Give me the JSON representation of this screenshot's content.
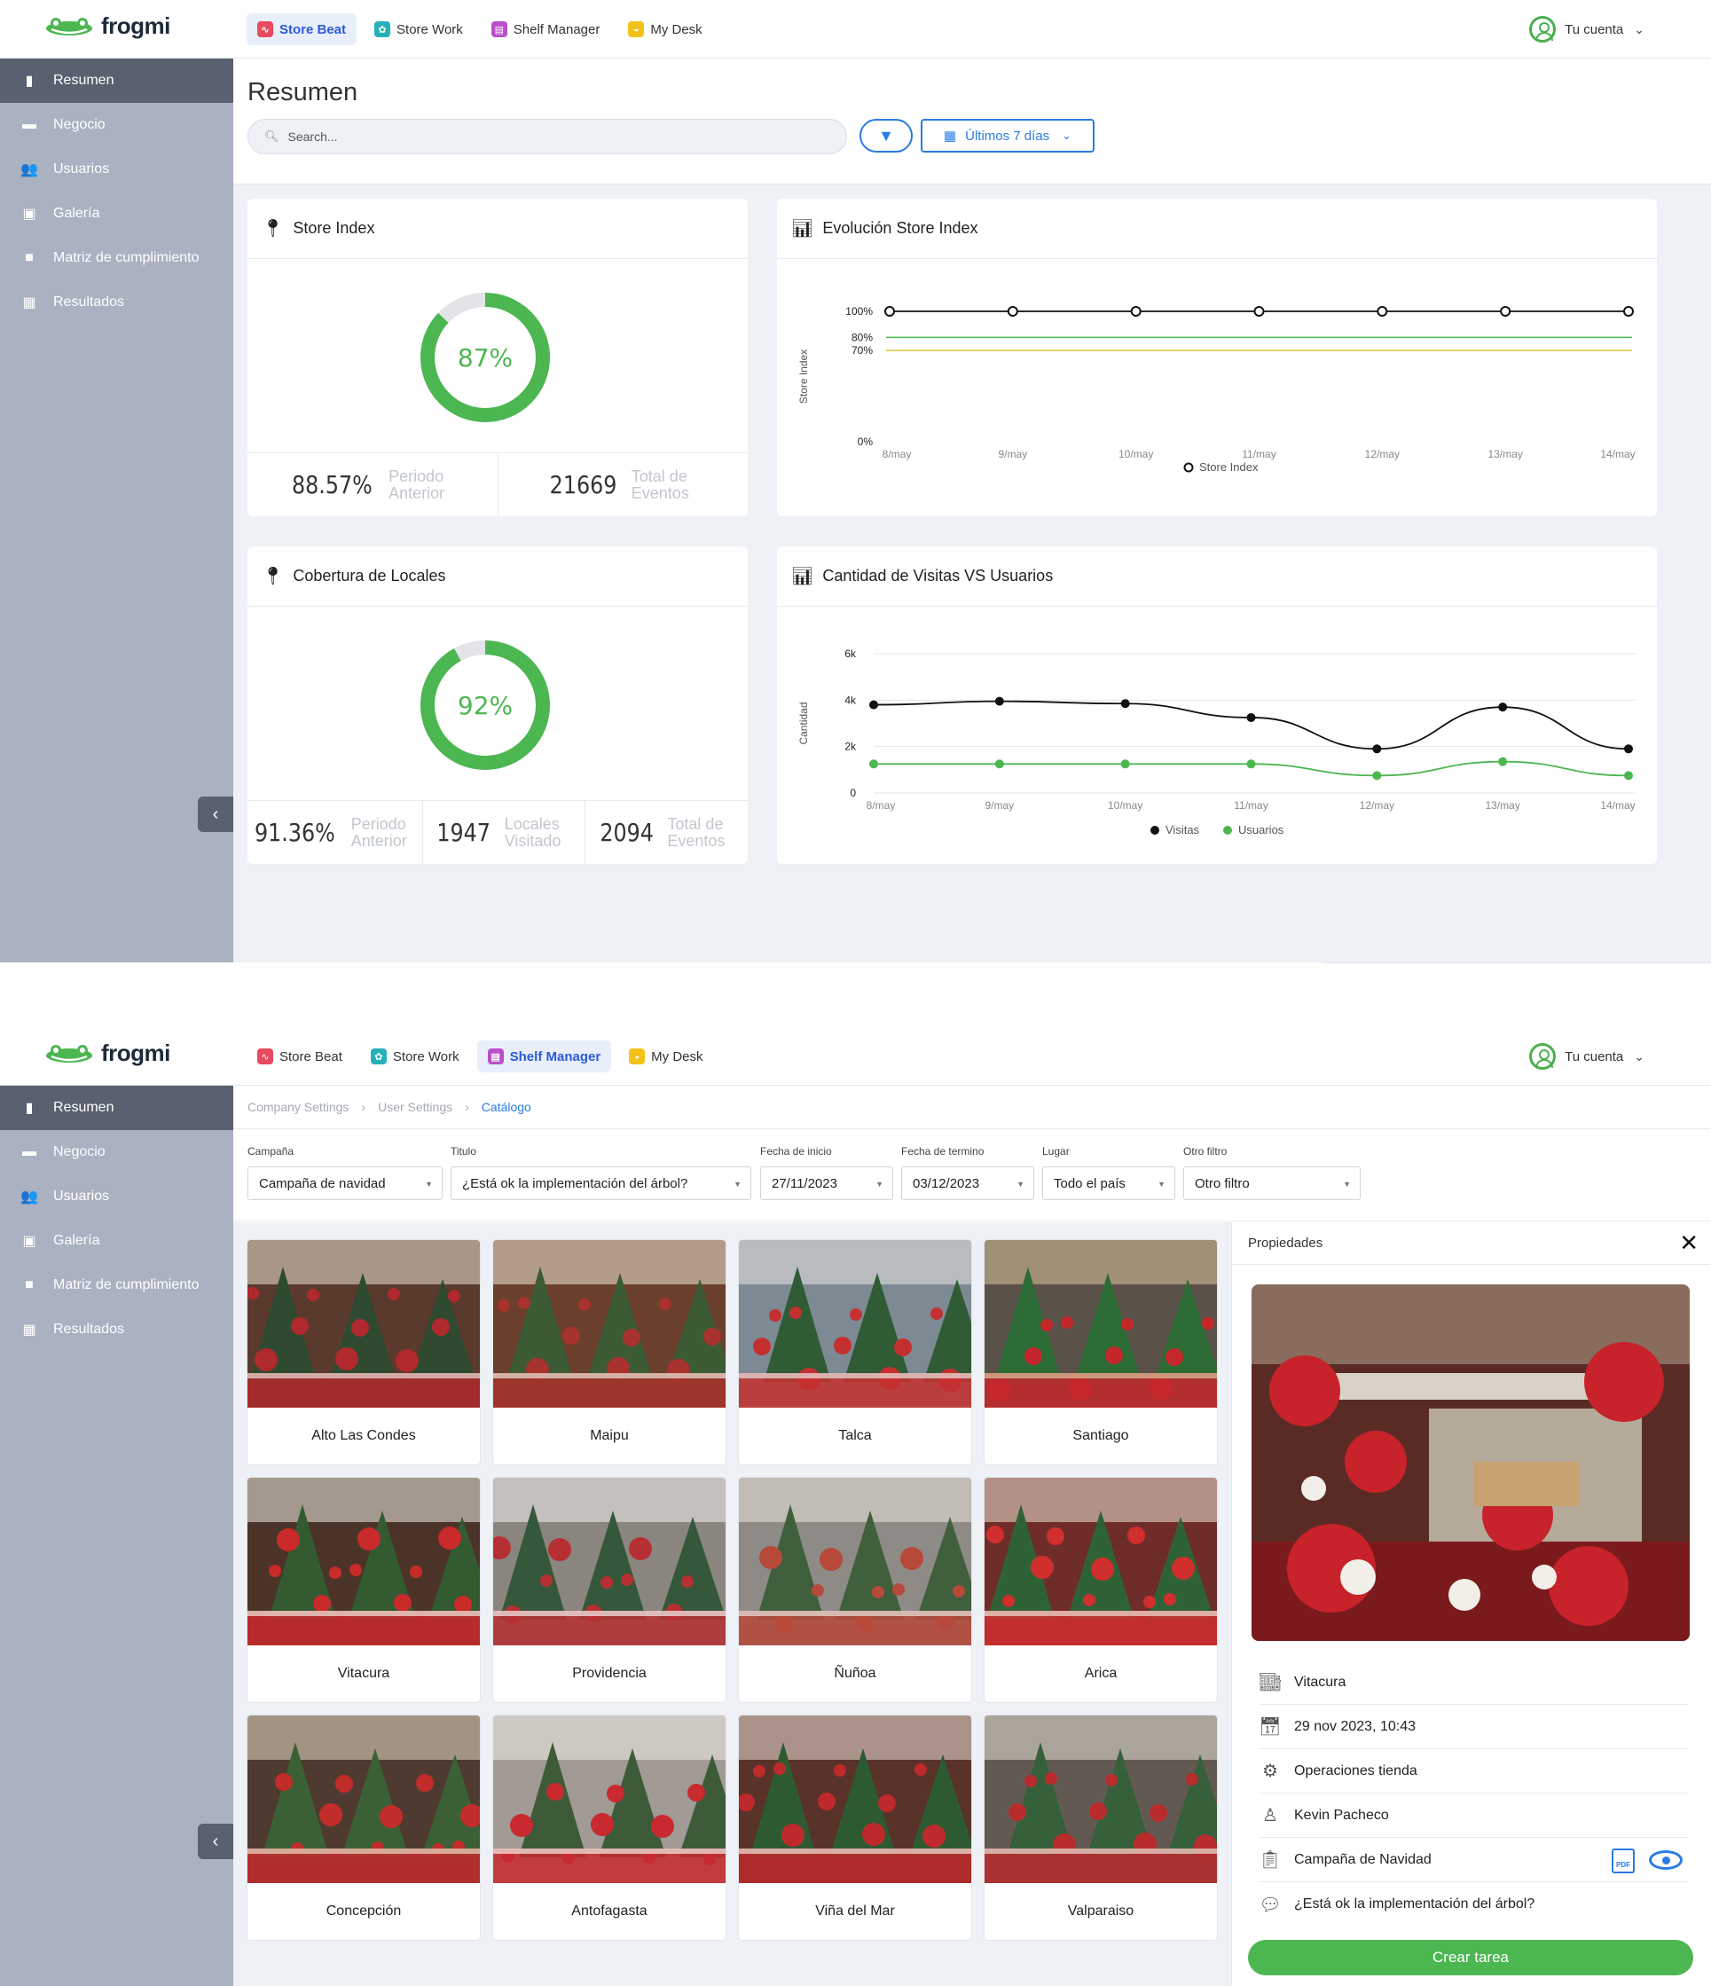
{
  "brand": {
    "name": "frogmi"
  },
  "apps": [
    {
      "label": "Store Beat",
      "color": "#e84a5f"
    },
    {
      "label": "Store Work",
      "color": "#27b0b8"
    },
    {
      "label": "Shelf Manager",
      "color": "#b94fc9"
    },
    {
      "label": "My Desk",
      "color": "#f2c21b"
    }
  ],
  "account": {
    "label": "Tu cuenta"
  },
  "sidebar": {
    "items": [
      {
        "label": "Resumen",
        "icon": "file-icon"
      },
      {
        "label": "Negocio",
        "icon": "briefcase-icon"
      },
      {
        "label": "Usuarios",
        "icon": "users-icon"
      },
      {
        "label": "Galería",
        "icon": "image-icon"
      },
      {
        "label": "Matriz de cumplimiento",
        "icon": "folder-icon"
      },
      {
        "label": "Resultados",
        "icon": "bar-chart-icon"
      }
    ]
  },
  "screen1": {
    "title": "Resumen",
    "search_placeholder": "Search...",
    "date_range": "Últimos 7 días",
    "store_index": {
      "title": "Store Index",
      "value": 87,
      "value_label": "87%",
      "stats": [
        {
          "value": "88.57%",
          "label": "Periodo Anterior"
        },
        {
          "value": "21669",
          "label": "Total de Eventos"
        }
      ]
    },
    "coverage": {
      "title": "Cobertura de Locales",
      "value": 92,
      "value_label": "92%",
      "stats": [
        {
          "value": "91.36%",
          "label": "Periodo Anterior"
        },
        {
          "value": "1947",
          "label": "Locales Visitado"
        },
        {
          "value": "2094",
          "label": "Total de Eventos"
        }
      ]
    },
    "evolution_title": "Evolución Store Index",
    "visits_title": "Cantidad de Visitas VS Usuarios"
  },
  "chart_data": [
    {
      "type": "line",
      "title": "Evolución Store Index",
      "ylabel": "Store Index",
      "x": [
        "8/may",
        "9/may",
        "10/may",
        "11/may",
        "12/may",
        "13/may",
        "14/may"
      ],
      "y_ticks": [
        "100%",
        "80%",
        "70%",
        "0%"
      ],
      "ylim": [
        0,
        100
      ],
      "series": [
        {
          "name": "Store Index",
          "values": [
            100,
            100,
            100,
            100,
            100,
            100,
            100
          ],
          "color": "#111111"
        }
      ],
      "reference_lines": [
        {
          "value": 80,
          "color": "#4cb651"
        },
        {
          "value": 70,
          "color": "#e0c23a"
        }
      ],
      "legend": "bottom"
    },
    {
      "type": "line",
      "title": "Cantidad de Visitas VS Usuarios",
      "ylabel": "Cantidad",
      "x": [
        "8/may",
        "9/may",
        "10/may",
        "11/may",
        "12/may",
        "13/may",
        "14/may"
      ],
      "y_ticks": [
        "6k",
        "4k",
        "2k",
        "0"
      ],
      "ylim": [
        0,
        6000
      ],
      "series": [
        {
          "name": "Visitas",
          "values": [
            3800,
            3950,
            3850,
            3250,
            1900,
            3700,
            1900
          ],
          "color": "#111111"
        },
        {
          "name": "Usuarios",
          "values": [
            1250,
            1250,
            1250,
            1250,
            750,
            1350,
            750
          ],
          "color": "#4cb651"
        }
      ],
      "legend": "bottom"
    }
  ],
  "screen2": {
    "breadcrumbs": [
      "Company Settings",
      "User Settings",
      "Catálogo"
    ],
    "filters": [
      {
        "label": "Campaña",
        "value": "Campaña de navidad"
      },
      {
        "label": "Titulo",
        "value": "¿Está ok la implementación del árbol?"
      },
      {
        "label": "Fecha de inicio",
        "value": "27/11/2023"
      },
      {
        "label": "Fecha de termino",
        "value": "03/12/2023"
      },
      {
        "label": "Lugar",
        "value": "Todo el país"
      },
      {
        "label": "Otro filtro",
        "value": "Otro filtro"
      }
    ],
    "tiles": [
      "Alto Las Condes",
      "Maipu",
      "Talca",
      "Santiago",
      "Vitacura",
      "Providencia",
      "Ñuñoa",
      "Arica",
      "Concepción",
      "Antofagasta",
      "Viña del Mar",
      "Valparaiso"
    ],
    "scroll_progress": 0.25,
    "panel": {
      "title": "Propiedades",
      "rows": [
        {
          "icon": "store-icon",
          "text": "Vitacura"
        },
        {
          "icon": "calendar-icon",
          "text": "29 nov 2023, 10:43"
        },
        {
          "icon": "gear-icon",
          "text": "Operaciones tienda"
        },
        {
          "icon": "person-icon",
          "text": "Kevin Pacheco"
        },
        {
          "icon": "clipboard-icon",
          "text": "Campaña de Navidad"
        },
        {
          "icon": "chat-icon",
          "text": "¿Está ok la implementación del árbol?"
        }
      ],
      "pdf_label": "PDF",
      "create_button": "Crear tarea"
    }
  }
}
